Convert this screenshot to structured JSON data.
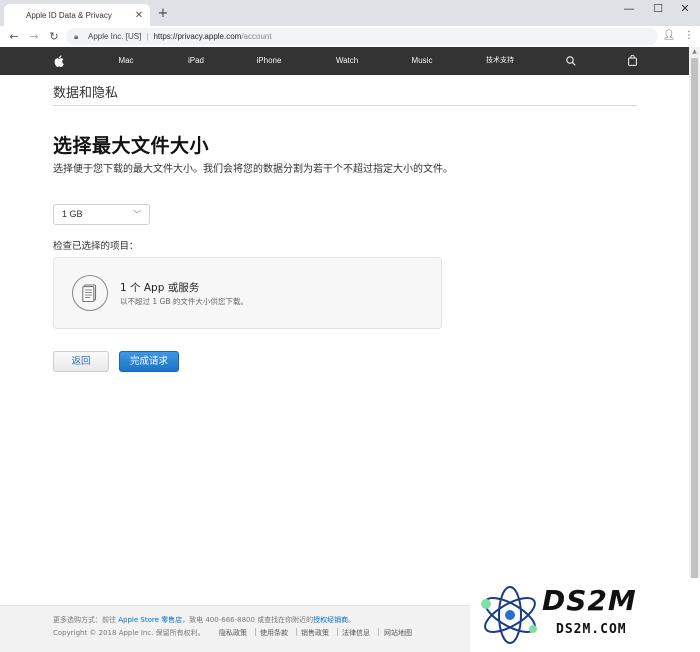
{
  "browser": {
    "tab_title": "Apple ID Data & Privacy",
    "tab_close": "✕",
    "new_tab": "+",
    "controls": {
      "minimize": "—",
      "maximize": "☐",
      "close": "✕"
    },
    "address": {
      "org": "Apple Inc. [US]",
      "separator": "|",
      "url_host": "https://privacy.apple.com",
      "url_path": "/account"
    }
  },
  "nav": {
    "items": [
      "Mac",
      "iPad",
      "iPhone",
      "Watch",
      "Music",
      "技术支持"
    ]
  },
  "page": {
    "section_title": "数据和隐私",
    "heading": "选择最大文件大小",
    "description": "选择便于您下载的最大文件大小。我们会将您的数据分割为若干个不超过指定大小的文件。",
    "size_select": {
      "value": "1 GB"
    },
    "check_label": "检查已选择的项目：",
    "card": {
      "title": "1 个 App 或服务",
      "subtitle": "以不超过 1 GB 的文件大小供您下载。"
    },
    "buttons": {
      "back": "返回",
      "done": "完成请求"
    }
  },
  "footer": {
    "shop_prefix": "更多选购方式：前往 ",
    "store_link": "Apple Store 零售店",
    "shop_mid": "，致电 400-666-8800 或查找在你附近的",
    "reseller_link": "授权经销商",
    "shop_end": "。",
    "copyright": "Copyright © 2018 Apple Inc. 保留所有权利。",
    "links": [
      "隐私政策",
      "使用条款",
      "销售政策",
      "法律信息",
      "网站地图"
    ]
  },
  "watermark": {
    "logo": "DS2M",
    "site": "DS2M.COM"
  }
}
